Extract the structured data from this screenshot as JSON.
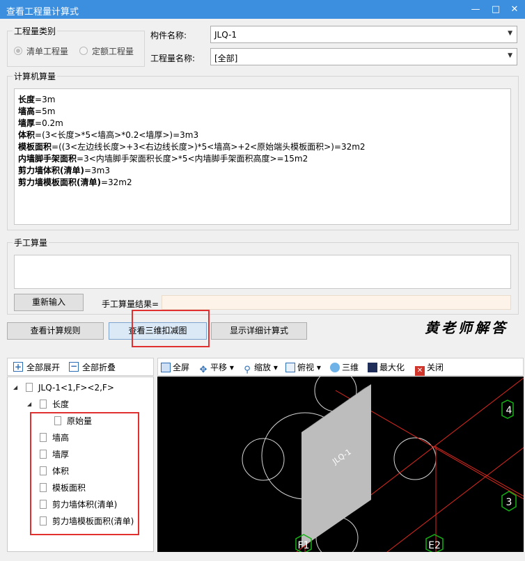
{
  "window": {
    "title": "查看工程量计算式",
    "buttons": [
      "minimize-icon",
      "maximize-icon",
      "close-icon"
    ]
  },
  "type_group": {
    "label": "工程量类别",
    "options": [
      {
        "label": "清单工程量",
        "checked": true
      },
      {
        "label": "定额工程量",
        "checked": false
      }
    ]
  },
  "component": {
    "label": "构件名称:",
    "value": "JLQ-1"
  },
  "quantity": {
    "label": "工程量名称:",
    "value": "[全部]"
  },
  "computer_calc": {
    "label": "计算机算量",
    "lines": [
      {
        "name": "长度",
        "expr": "=3m"
      },
      {
        "name": "墙高",
        "expr": "=5m"
      },
      {
        "name": "墙厚",
        "expr": "=0.2m"
      },
      {
        "name": "体积",
        "expr": "=(3<长度>*5<墙高>*0.2<墙厚>)=3m3"
      },
      {
        "name": "模板面积",
        "expr": "=((3<左边线长度>+3<右边线长度>)*5<墙高>+2<原始端头模板面积>)=32m2"
      },
      {
        "name": "内墙脚手架面积",
        "expr": "=3<内墙脚手架面积长度>*5<内墙脚手架面积高度>=15m2"
      },
      {
        "name": "剪力墙体积(清单)",
        "expr": "=3m3"
      },
      {
        "name": "剪力墙模板面积(清单)",
        "expr": "=32m2"
      }
    ]
  },
  "manual_calc": {
    "label": "手工算量",
    "reenter_button": "重新输入",
    "result_label": "手工算量结果=",
    "result_value": ""
  },
  "actions": {
    "rules": "查看计算规则",
    "view3d": "查看三维扣减图",
    "details": "显示详细计算式"
  },
  "watermark": "黄老师解答",
  "tree_toolbar": {
    "expand_all": "全部展开",
    "collapse_all": "全部折叠"
  },
  "tree": {
    "root": "JLQ-1<1,F><2,F>",
    "length": "长度",
    "original": "原始量",
    "items": [
      "墙高",
      "墙厚",
      "体积",
      "模板面积",
      "剪力墙体积(清单)",
      "剪力墙模板面积(清单)"
    ]
  },
  "view_toolbar": {
    "fullscreen": "全屏",
    "pan": "平移",
    "zoom": "缩放",
    "view": "俯视",
    "three_d": "三维",
    "maximize": "最大化",
    "close": "关闭"
  },
  "view3d": {
    "wall_label": "JLQ-1",
    "axis_labels": [
      "4",
      "3",
      "F1",
      "E2"
    ],
    "colors": {
      "grid": "#e0281e",
      "axis_marker": "#13b313",
      "wall": "#bdbdbd",
      "highlight": "#e03030"
    }
  }
}
